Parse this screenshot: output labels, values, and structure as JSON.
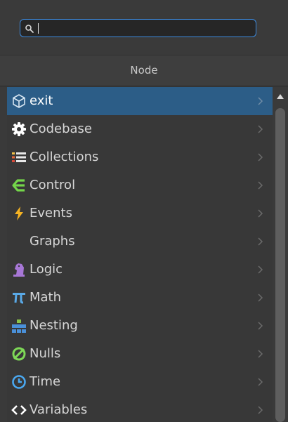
{
  "search": {
    "value": "",
    "placeholder": ""
  },
  "panel": {
    "title": "Node"
  },
  "items": [
    {
      "label": "exit",
      "icon": "cube-icon",
      "selected": true
    },
    {
      "label": "Codebase",
      "icon": "gear-icon",
      "selected": false
    },
    {
      "label": "Collections",
      "icon": "list-icon",
      "selected": false
    },
    {
      "label": "Control",
      "icon": "control-flow-icon",
      "selected": false
    },
    {
      "label": "Events",
      "icon": "lightning-icon",
      "selected": false
    },
    {
      "label": "Graphs",
      "icon": "",
      "selected": false
    },
    {
      "label": "Logic",
      "icon": "chess-knight-icon",
      "selected": false
    },
    {
      "label": "Math",
      "icon": "pi-icon",
      "selected": false
    },
    {
      "label": "Nesting",
      "icon": "nesting-icon",
      "selected": false
    },
    {
      "label": "Nulls",
      "icon": "null-icon",
      "selected": false
    },
    {
      "label": "Time",
      "icon": "clock-icon",
      "selected": false
    },
    {
      "label": "Variables",
      "icon": "angle-brackets-icon",
      "selected": false
    }
  ],
  "colors": {
    "selection": "#2c5d87",
    "search_border": "#3d8be0",
    "background": "#383838"
  }
}
